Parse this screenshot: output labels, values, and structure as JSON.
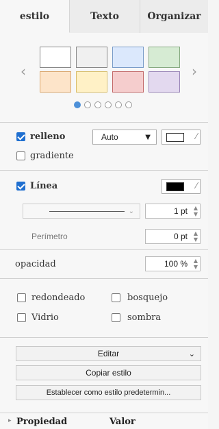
{
  "tabs": [
    {
      "label": "estilo"
    },
    {
      "label": "Texto"
    },
    {
      "label": "Organizar"
    }
  ],
  "colors": {
    "swatch_white": "#ffffff",
    "swatch_gray": "#f0f0f0",
    "swatch_blue": "#dbe8fc",
    "swatch_green": "#d6ebd3",
    "swatch_orange": "#fde4c9",
    "swatch_yellow": "#fff1c6",
    "swatch_red": "#f5cdcd",
    "swatch_purple": "#e3d9ef",
    "accent": "#1f6fd0"
  },
  "fill": {
    "relleno_label": "relleno",
    "relleno_value": "Auto",
    "gradiente_label": "gradiente"
  },
  "line": {
    "linea_label": "Línea",
    "width_value": "1 pt",
    "perimetro_label": "Perímetro",
    "perimetro_value": "0 pt"
  },
  "opacity": {
    "label": "opacidad",
    "value": "100 %"
  },
  "options": {
    "redondeado": "redondeado",
    "bosquejo": "bosquejo",
    "vidrio": "Vidrio",
    "sombra": "sombra"
  },
  "actions": {
    "editar": "Editar",
    "copiar": "Copiar estilo",
    "establecer": "Establecer como estilo predetermin..."
  },
  "props": {
    "propiedad": "Propiedad",
    "valor": "Valor"
  }
}
